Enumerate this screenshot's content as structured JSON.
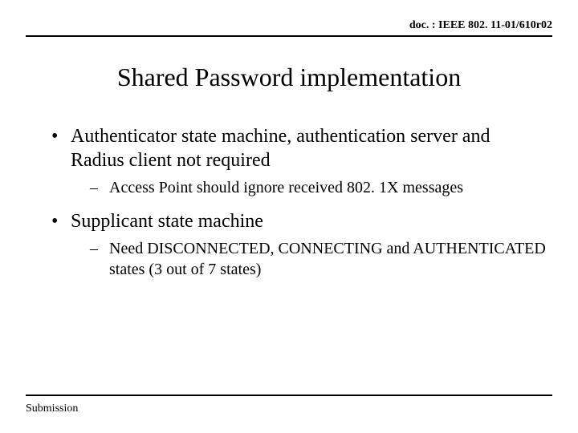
{
  "header": {
    "doc_ref": "doc. : IEEE 802. 11-01/610r02"
  },
  "title": "Shared Password implementation",
  "body": {
    "bullets": [
      {
        "text": "Authenticator state machine, authentication server and Radius client not required",
        "subs": [
          "Access Point should ignore received 802. 1X messages"
        ]
      },
      {
        "text": "Supplicant state machine",
        "subs": [
          "Need DISCONNECTED, CONNECTING and AUTHENTICATED states (3 out of 7 states)"
        ]
      }
    ]
  },
  "footer": {
    "label": "Submission"
  }
}
